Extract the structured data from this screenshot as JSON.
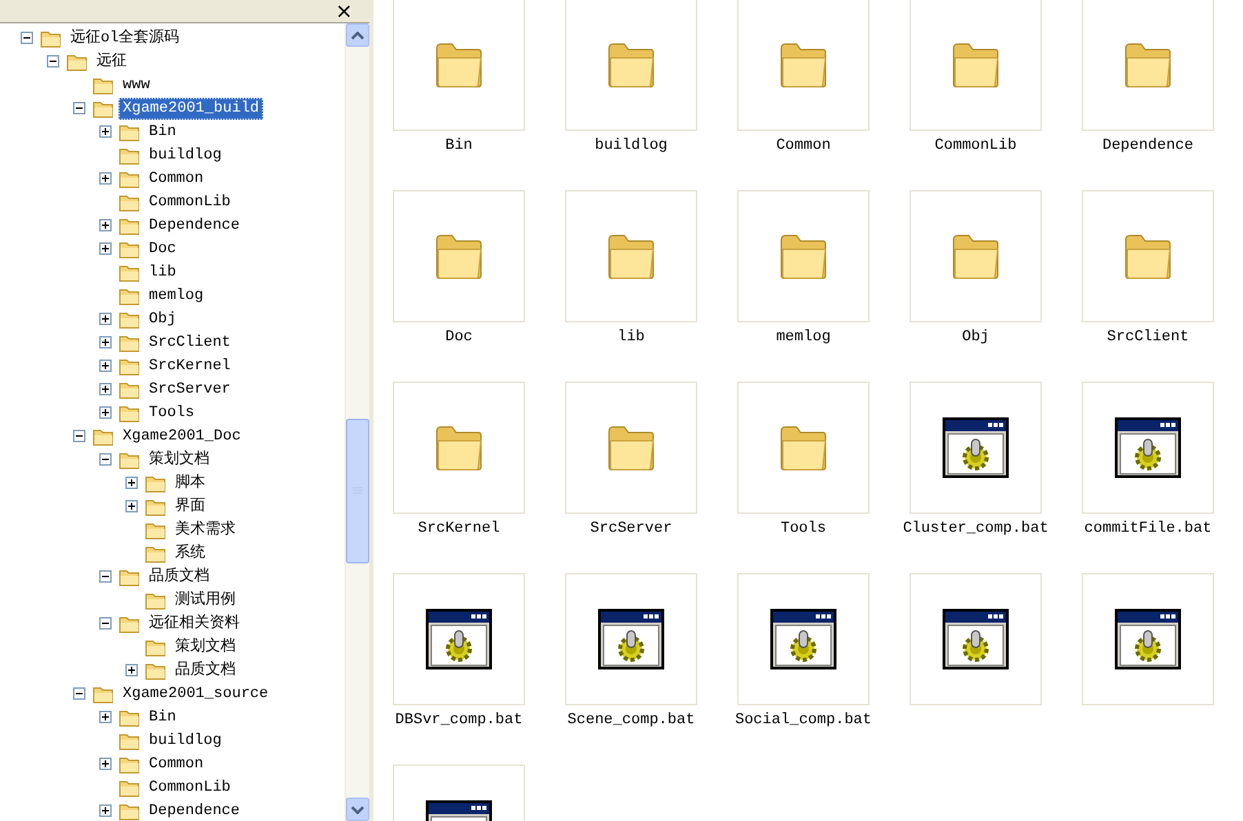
{
  "folders_pane": {
    "close_label": "×",
    "tree": [
      {
        "label": "远征ol全套源码",
        "kind": "branch",
        "expanded": true,
        "selected": false,
        "children": [
          {
            "label": "远征",
            "kind": "branch",
            "expanded": true,
            "selected": false,
            "children": [
              {
                "label": "www",
                "kind": "leaf",
                "selected": false
              },
              {
                "label": "Xgame2001_build",
                "kind": "branch",
                "expanded": true,
                "selected": true,
                "children": [
                  {
                    "label": "Bin",
                    "kind": "branch",
                    "expanded": false,
                    "selected": false
                  },
                  {
                    "label": "buildlog",
                    "kind": "leaf",
                    "selected": false
                  },
                  {
                    "label": "Common",
                    "kind": "branch",
                    "expanded": false,
                    "selected": false
                  },
                  {
                    "label": "CommonLib",
                    "kind": "leaf",
                    "selected": false
                  },
                  {
                    "label": "Dependence",
                    "kind": "branch",
                    "expanded": false,
                    "selected": false
                  },
                  {
                    "label": "Doc",
                    "kind": "branch",
                    "expanded": false,
                    "selected": false
                  },
                  {
                    "label": "lib",
                    "kind": "leaf",
                    "selected": false
                  },
                  {
                    "label": "memlog",
                    "kind": "leaf",
                    "selected": false
                  },
                  {
                    "label": "Obj",
                    "kind": "branch",
                    "expanded": false,
                    "selected": false
                  },
                  {
                    "label": "SrcClient",
                    "kind": "branch",
                    "expanded": false,
                    "selected": false
                  },
                  {
                    "label": "SrcKernel",
                    "kind": "branch",
                    "expanded": false,
                    "selected": false
                  },
                  {
                    "label": "SrcServer",
                    "kind": "branch",
                    "expanded": false,
                    "selected": false
                  },
                  {
                    "label": "Tools",
                    "kind": "branch",
                    "expanded": false,
                    "selected": false
                  }
                ]
              },
              {
                "label": "Xgame2001_Doc",
                "kind": "branch",
                "expanded": true,
                "selected": false,
                "children": [
                  {
                    "label": "策划文档",
                    "kind": "branch",
                    "expanded": true,
                    "selected": false,
                    "children": [
                      {
                        "label": "脚本",
                        "kind": "branch",
                        "expanded": false,
                        "selected": false
                      },
                      {
                        "label": "界面",
                        "kind": "branch",
                        "expanded": false,
                        "selected": false
                      },
                      {
                        "label": "美术需求",
                        "kind": "leaf",
                        "selected": false
                      },
                      {
                        "label": "系统",
                        "kind": "leaf",
                        "selected": false
                      }
                    ]
                  },
                  {
                    "label": "品质文档",
                    "kind": "branch",
                    "expanded": true,
                    "selected": false,
                    "children": [
                      {
                        "label": "测试用例",
                        "kind": "leaf",
                        "selected": false
                      }
                    ]
                  },
                  {
                    "label": "远征相关资料",
                    "kind": "branch",
                    "expanded": true,
                    "selected": false,
                    "children": [
                      {
                        "label": "策划文档",
                        "kind": "leaf",
                        "selected": false
                      },
                      {
                        "label": "品质文档",
                        "kind": "branch",
                        "expanded": false,
                        "selected": false
                      }
                    ]
                  }
                ]
              },
              {
                "label": "Xgame2001_source",
                "kind": "branch",
                "expanded": true,
                "selected": false,
                "children": [
                  {
                    "label": "Bin",
                    "kind": "branch",
                    "expanded": false,
                    "selected": false
                  },
                  {
                    "label": "buildlog",
                    "kind": "leaf",
                    "selected": false
                  },
                  {
                    "label": "Common",
                    "kind": "branch",
                    "expanded": false,
                    "selected": false
                  },
                  {
                    "label": "CommonLib",
                    "kind": "leaf",
                    "selected": false
                  },
                  {
                    "label": "Dependence",
                    "kind": "branch",
                    "expanded": false,
                    "selected": false
                  }
                ]
              }
            ]
          }
        ]
      }
    ]
  },
  "files": [
    {
      "kind": "folder",
      "name": "Bin"
    },
    {
      "kind": "folder",
      "name": "buildlog"
    },
    {
      "kind": "folder",
      "name": "Common"
    },
    {
      "kind": "folder",
      "name": "CommonLib"
    },
    {
      "kind": "folder",
      "name": "Dependence"
    },
    {
      "kind": "folder",
      "name": "Doc"
    },
    {
      "kind": "folder",
      "name": "lib"
    },
    {
      "kind": "folder",
      "name": "memlog"
    },
    {
      "kind": "folder",
      "name": "Obj"
    },
    {
      "kind": "folder",
      "name": "SrcClient"
    },
    {
      "kind": "folder",
      "name": "SrcKernel"
    },
    {
      "kind": "folder",
      "name": "SrcServer"
    },
    {
      "kind": "folder",
      "name": "Tools"
    },
    {
      "kind": "batch",
      "name": "Cluster_comp.bat"
    },
    {
      "kind": "batch",
      "name": "commitFile.bat"
    },
    {
      "kind": "batch",
      "name": "DBSvr_comp.bat"
    },
    {
      "kind": "batch",
      "name": "Scene_comp.bat"
    },
    {
      "kind": "batch",
      "name": "Social_comp.bat"
    },
    {
      "kind": "batch"
    },
    {
      "kind": "batch"
    },
    {
      "kind": "batch"
    }
  ]
}
